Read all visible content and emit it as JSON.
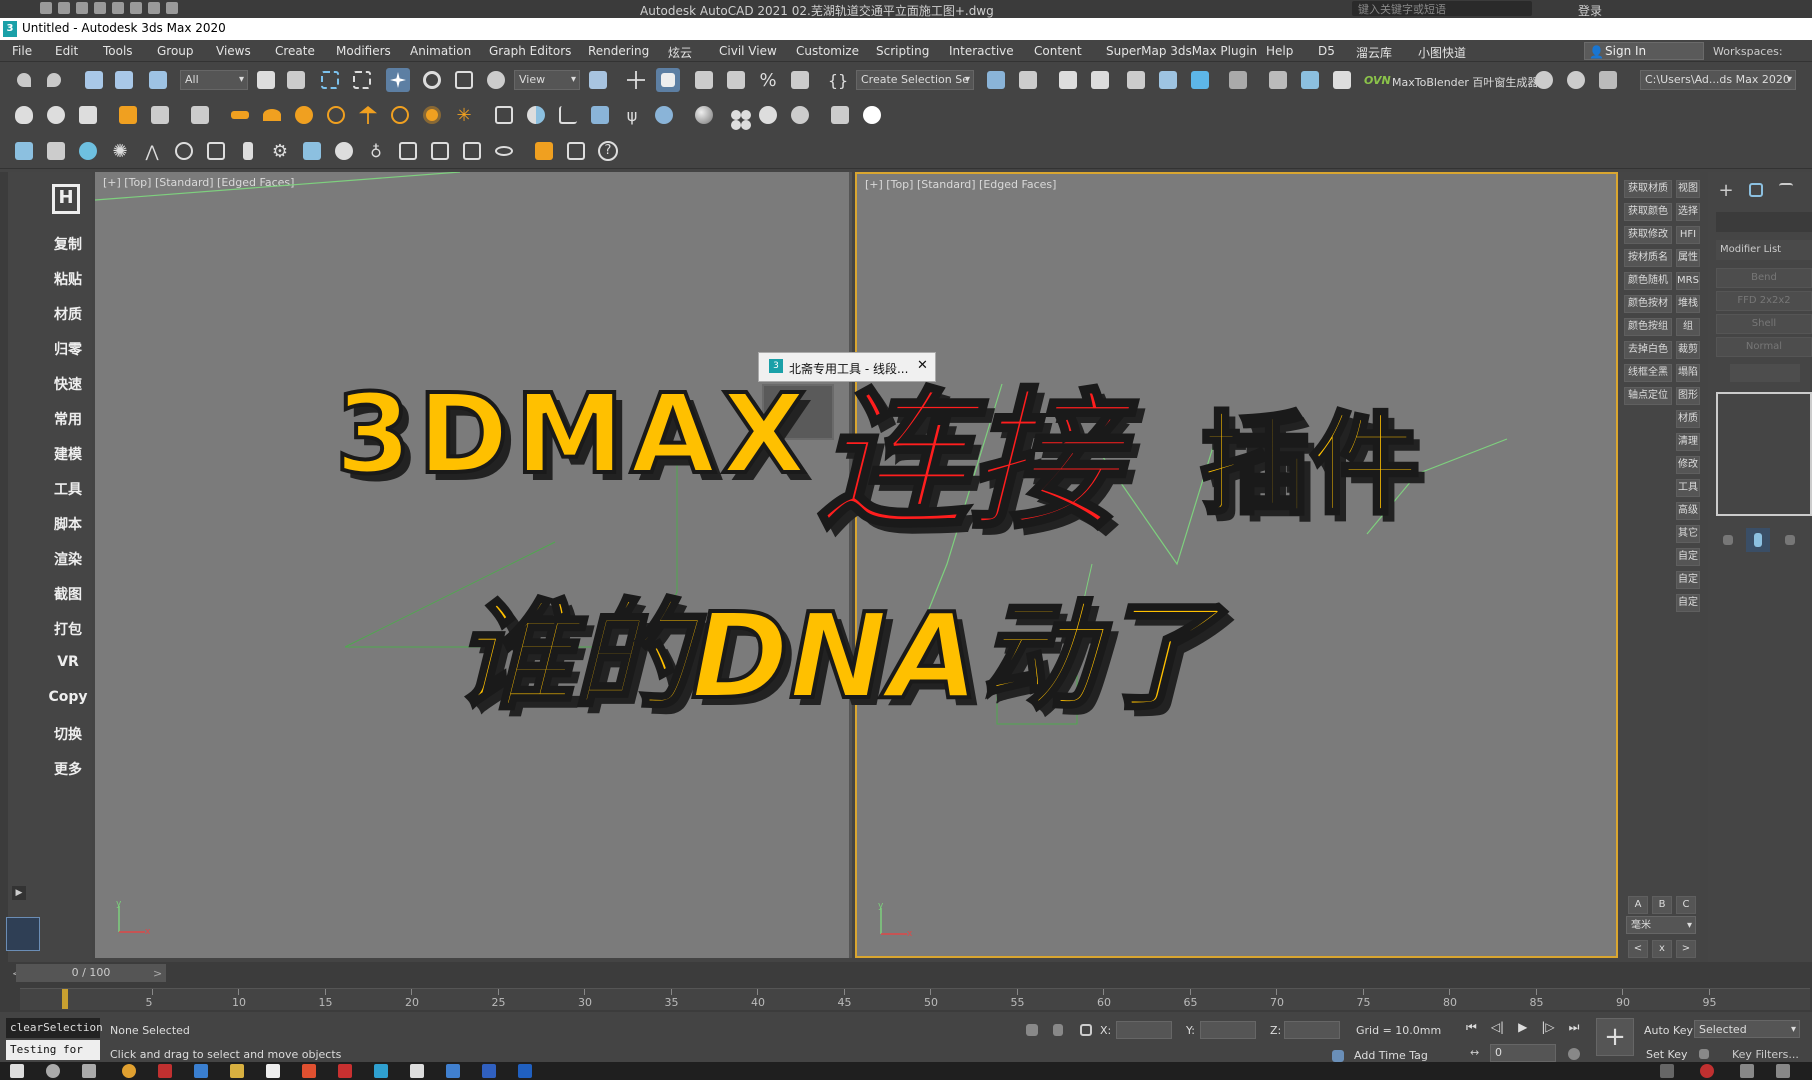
{
  "acad_bar": {
    "title": "Autodesk AutoCAD 2021    02.芜湖轨道交通平立面施工图+.dwg",
    "search_placeholder": "键入关键字或短语",
    "login": "登录"
  },
  "window": {
    "title": "Untitled - Autodesk 3ds Max 2020",
    "app_icon": "3"
  },
  "menu": [
    "File",
    "Edit",
    "Tools",
    "Group",
    "Views",
    "Create",
    "Modifiers",
    "Animation",
    "Graph Editors",
    "Rendering",
    "炫云",
    "Civil View",
    "Customize",
    "Scripting",
    "Interactive",
    "Content",
    "SuperMap 3dsMax Plugin",
    "Help",
    "D5",
    "溜云库",
    "小图快道"
  ],
  "signin": "Sign In",
  "workspaces": "Workspaces:",
  "toolbar": {
    "filter": "All",
    "coord": "View",
    "selection_set": "Create Selection Se",
    "ovn": "OVN",
    "maxtoblender": "MaxToBlender 百叶窗生成器",
    "path": "C:\\Users\\Ad...ds Max 2020"
  },
  "left_menu": [
    "复制",
    "粘贴",
    "材质",
    "归零",
    "快速",
    "常用",
    "建模",
    "工具",
    "脚本",
    "渲染",
    "截图",
    "打包",
    "VR",
    "Copy",
    "切换",
    "更多"
  ],
  "viewports": {
    "left_label": "[+] [Top] [Standard] [Edged Faces]",
    "right_label": "[+] [Top] [Standard] [Edged Faces]"
  },
  "dialog": {
    "title": "北斋专用工具 - 线段...",
    "close": "✕"
  },
  "overlay": {
    "line1_a": "3DMAX",
    "line1_b": "连接",
    "line1_c": "插件",
    "line2": "谁的DNA动了"
  },
  "right_buttons_left": [
    "获取材质",
    "获取颜色",
    "获取修改",
    "按材质名",
    "颜色随机",
    "颜色按材",
    "颜色按组",
    "去掉白色",
    "线框全黑",
    "轴点定位"
  ],
  "right_buttons_right": [
    "视图",
    "选择",
    "HFI",
    "属性",
    "MRS",
    "堆栈",
    "组",
    "裁剪",
    "塌陷",
    "图形",
    "材质",
    "清理",
    "修改",
    "工具",
    "高级",
    "其它",
    "自定",
    "自定",
    "自定"
  ],
  "abc": [
    "A",
    "B",
    "C"
  ],
  "unit": "毫米",
  "nav": [
    "<",
    "x",
    ">"
  ],
  "command_panel": {
    "modifier_list": "Modifier List",
    "mods": [
      "Bend",
      "FFD 2x2x2",
      "Shell",
      "Normal"
    ]
  },
  "timeline": {
    "frame": "0 / 100",
    "ticks": [
      0,
      5,
      10,
      15,
      20,
      25,
      30,
      35,
      40,
      45,
      50,
      55,
      60,
      65,
      70,
      75,
      80,
      85,
      90,
      95
    ]
  },
  "status": {
    "maxscript1": "clearSelection",
    "maxscript2": "Testing for AU",
    "selected": "None Selected",
    "prompt": "Click and drag to select and move objects",
    "x": "X:",
    "y": "Y:",
    "z": "Z:",
    "grid": "Grid = 10.0mm",
    "add_time_tag": "Add Time Tag",
    "auto_key": "Auto Key",
    "set_key": "Set Key",
    "selected_dd": "Selected",
    "key_filters": "Key Filters...",
    "frame_field": "0"
  }
}
